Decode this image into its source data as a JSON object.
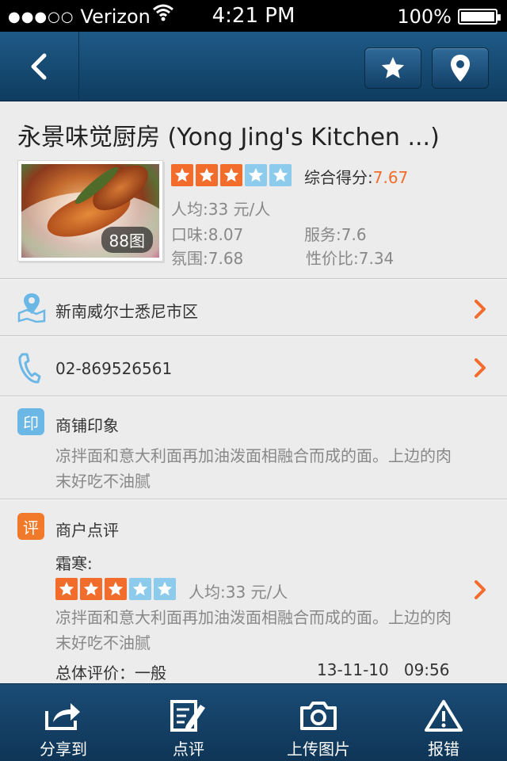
{
  "status_bar": {
    "signal": "●●●○○",
    "carrier": "Verizon",
    "time": "4:21 PM",
    "battery": "100%"
  },
  "restaurant": {
    "name": "永景味觉厨房 (Yong Jing's Kitchen ...)",
    "photo_count": "88图",
    "star_rating": 3,
    "star_max": 5,
    "overall_label": "综合得分:",
    "overall_value": "7.67",
    "per_person": "人均:33 元/人",
    "taste": "口味:8.07",
    "service": "服务:7.6",
    "ambience": "氛围:7.68",
    "value": "性价比:7.34"
  },
  "address": {
    "text": "新南威尔士悉尼市区",
    "icon": "map-pin-icon"
  },
  "phone": {
    "text": "02-869526561",
    "icon": "phone-icon"
  },
  "impression": {
    "badge": "印",
    "title": "商铺印象",
    "text": "凉拌面和意大利面再加油泼面相融合而成的面。上边的肉末好吃不油腻"
  },
  "review": {
    "badge": "评",
    "title": "商户点评",
    "author": "霜寒:",
    "stars": 3,
    "per_person": "人均:33 元/人",
    "text": "凉拌面和意大利面再加油泼面相融合而成的面。上边的肉末好吃不油腻",
    "overall": "总体评价：一般",
    "date": "13-11-10   09:56"
  },
  "tabs": [
    {
      "label": "分享到",
      "icon": "share-icon"
    },
    {
      "label": "点评",
      "icon": "edit-review-icon"
    },
    {
      "label": "上传图片",
      "icon": "camera-icon"
    },
    {
      "label": "报错",
      "icon": "warning-icon"
    }
  ],
  "colors": {
    "accent": "#f26c2b",
    "star_off": "#8ccbec",
    "nav": "#1a4c76"
  }
}
